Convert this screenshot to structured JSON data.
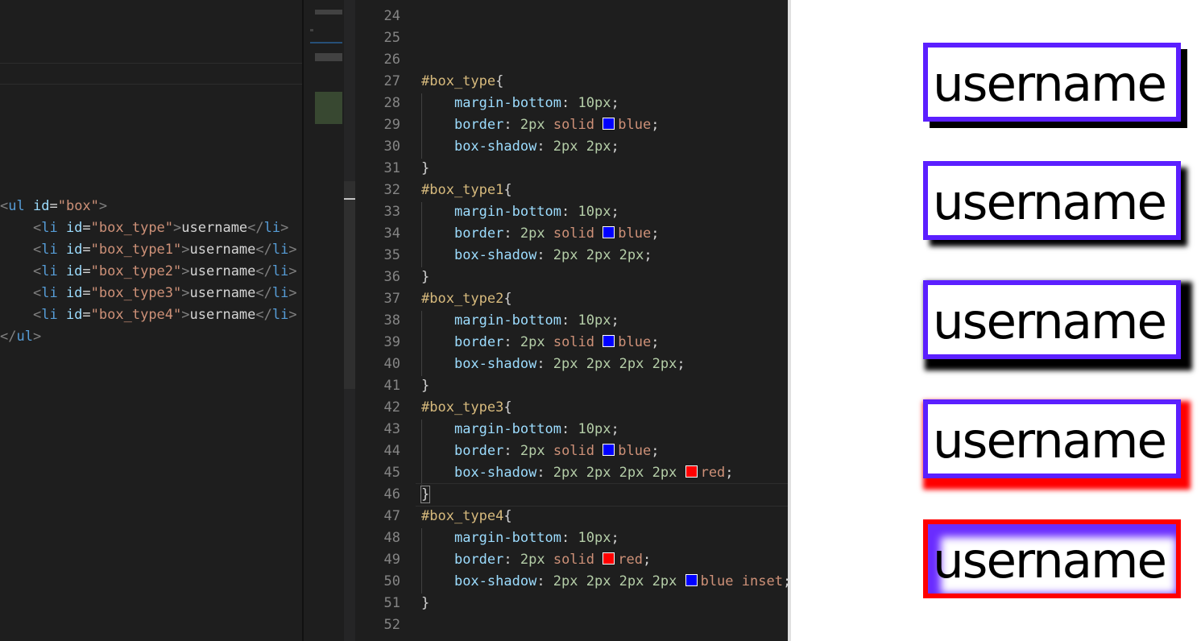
{
  "html_panel": {
    "lines": [
      [
        {
          "c": "t-punc",
          "t": "<"
        },
        {
          "c": "t-tag",
          "t": "ul"
        },
        {
          "c": "t-txt",
          "t": " "
        },
        {
          "c": "t-attr",
          "t": "id"
        },
        {
          "c": "t-eq",
          "t": "="
        },
        {
          "c": "t-str",
          "t": "\"box\""
        },
        {
          "c": "t-punc",
          "t": ">"
        }
      ],
      [
        {
          "c": "t-txt",
          "t": "    "
        },
        {
          "c": "t-punc",
          "t": "<"
        },
        {
          "c": "t-tag",
          "t": "li"
        },
        {
          "c": "t-txt",
          "t": " "
        },
        {
          "c": "t-attr",
          "t": "id"
        },
        {
          "c": "t-eq",
          "t": "="
        },
        {
          "c": "t-str",
          "t": "\"box_type\""
        },
        {
          "c": "t-punc",
          "t": ">"
        },
        {
          "c": "t-txt",
          "t": "username"
        },
        {
          "c": "t-punc",
          "t": "</"
        },
        {
          "c": "t-tag",
          "t": "li"
        },
        {
          "c": "t-punc",
          "t": ">"
        }
      ],
      [
        {
          "c": "t-txt",
          "t": "    "
        },
        {
          "c": "t-punc",
          "t": "<"
        },
        {
          "c": "t-tag",
          "t": "li"
        },
        {
          "c": "t-txt",
          "t": " "
        },
        {
          "c": "t-attr",
          "t": "id"
        },
        {
          "c": "t-eq",
          "t": "="
        },
        {
          "c": "t-str",
          "t": "\"box_type1\""
        },
        {
          "c": "t-punc",
          "t": ">"
        },
        {
          "c": "t-txt",
          "t": "username"
        },
        {
          "c": "t-punc",
          "t": "</"
        },
        {
          "c": "t-tag",
          "t": "li"
        },
        {
          "c": "t-punc",
          "t": ">"
        }
      ],
      [
        {
          "c": "t-txt",
          "t": "    "
        },
        {
          "c": "t-punc",
          "t": "<"
        },
        {
          "c": "t-tag",
          "t": "li"
        },
        {
          "c": "t-txt",
          "t": " "
        },
        {
          "c": "t-attr",
          "t": "id"
        },
        {
          "c": "t-eq",
          "t": "="
        },
        {
          "c": "t-str",
          "t": "\"box_type2\""
        },
        {
          "c": "t-punc",
          "t": ">"
        },
        {
          "c": "t-txt",
          "t": "username"
        },
        {
          "c": "t-punc",
          "t": "</"
        },
        {
          "c": "t-tag",
          "t": "li"
        },
        {
          "c": "t-punc",
          "t": ">"
        }
      ],
      [
        {
          "c": "t-txt",
          "t": "    "
        },
        {
          "c": "t-punc",
          "t": "<"
        },
        {
          "c": "t-tag",
          "t": "li"
        },
        {
          "c": "t-txt",
          "t": " "
        },
        {
          "c": "t-attr",
          "t": "id"
        },
        {
          "c": "t-eq",
          "t": "="
        },
        {
          "c": "t-str",
          "t": "\"box_type3\""
        },
        {
          "c": "t-punc",
          "t": ">"
        },
        {
          "c": "t-txt",
          "t": "username"
        },
        {
          "c": "t-punc",
          "t": "</"
        },
        {
          "c": "t-tag",
          "t": "li"
        },
        {
          "c": "t-punc",
          "t": ">"
        }
      ],
      [
        {
          "c": "t-txt",
          "t": "    "
        },
        {
          "c": "t-punc",
          "t": "<"
        },
        {
          "c": "t-tag",
          "t": "li"
        },
        {
          "c": "t-txt",
          "t": " "
        },
        {
          "c": "t-attr",
          "t": "id"
        },
        {
          "c": "t-eq",
          "t": "="
        },
        {
          "c": "t-str",
          "t": "\"box_type4\""
        },
        {
          "c": "t-punc",
          "t": ">"
        },
        {
          "c": "t-txt",
          "t": "username"
        },
        {
          "c": "t-punc",
          "t": "</"
        },
        {
          "c": "t-tag",
          "t": "li"
        },
        {
          "c": "t-punc",
          "t": ">"
        }
      ],
      [
        {
          "c": "t-punc",
          "t": "</"
        },
        {
          "c": "t-tag",
          "t": "ul"
        },
        {
          "c": "t-punc",
          "t": ">"
        }
      ]
    ]
  },
  "css_panel": {
    "lines": [
      {
        "n": "24",
        "p": []
      },
      {
        "n": "25",
        "p": []
      },
      {
        "n": "26",
        "p": []
      },
      {
        "n": "27",
        "p": [
          {
            "c": "sel",
            "t": "#box_type"
          },
          {
            "c": "brace",
            "t": "{"
          }
        ]
      },
      {
        "n": "28",
        "p": [
          {
            "c": "brace",
            "t": "    "
          },
          {
            "c": "prop",
            "t": "margin-bottom"
          },
          {
            "c": "brace",
            "t": ": "
          },
          {
            "c": "num",
            "t": "10px"
          },
          {
            "c": "brace",
            "t": ";"
          }
        ]
      },
      {
        "n": "29",
        "p": [
          {
            "c": "brace",
            "t": "    "
          },
          {
            "c": "prop",
            "t": "border"
          },
          {
            "c": "brace",
            "t": ": "
          },
          {
            "c": "num",
            "t": "2px"
          },
          {
            "c": "brace",
            "t": " "
          },
          {
            "c": "kw",
            "t": "solid"
          },
          {
            "c": "brace",
            "t": " "
          },
          {
            "c": "swatch",
            "t": "#0000ff"
          },
          {
            "c": "kw",
            "t": "blue"
          },
          {
            "c": "brace",
            "t": ";"
          }
        ]
      },
      {
        "n": "30",
        "p": [
          {
            "c": "brace",
            "t": "    "
          },
          {
            "c": "prop",
            "t": "box-shadow"
          },
          {
            "c": "brace",
            "t": ": "
          },
          {
            "c": "num",
            "t": "2px 2px"
          },
          {
            "c": "brace",
            "t": ";"
          }
        ]
      },
      {
        "n": "31",
        "p": [
          {
            "c": "brace",
            "t": "}"
          }
        ]
      },
      {
        "n": "32",
        "p": [
          {
            "c": "sel",
            "t": "#box_type1"
          },
          {
            "c": "brace",
            "t": "{"
          }
        ]
      },
      {
        "n": "33",
        "p": [
          {
            "c": "brace",
            "t": "    "
          },
          {
            "c": "prop",
            "t": "margin-bottom"
          },
          {
            "c": "brace",
            "t": ": "
          },
          {
            "c": "num",
            "t": "10px"
          },
          {
            "c": "brace",
            "t": ";"
          }
        ]
      },
      {
        "n": "34",
        "p": [
          {
            "c": "brace",
            "t": "    "
          },
          {
            "c": "prop",
            "t": "border"
          },
          {
            "c": "brace",
            "t": ": "
          },
          {
            "c": "num",
            "t": "2px"
          },
          {
            "c": "brace",
            "t": " "
          },
          {
            "c": "kw",
            "t": "solid"
          },
          {
            "c": "brace",
            "t": " "
          },
          {
            "c": "swatch",
            "t": "#0000ff"
          },
          {
            "c": "kw",
            "t": "blue"
          },
          {
            "c": "brace",
            "t": ";"
          }
        ]
      },
      {
        "n": "35",
        "p": [
          {
            "c": "brace",
            "t": "    "
          },
          {
            "c": "prop",
            "t": "box-shadow"
          },
          {
            "c": "brace",
            "t": ": "
          },
          {
            "c": "num",
            "t": "2px 2px 2px"
          },
          {
            "c": "brace",
            "t": ";"
          }
        ]
      },
      {
        "n": "36",
        "p": [
          {
            "c": "brace",
            "t": "}"
          }
        ]
      },
      {
        "n": "37",
        "p": [
          {
            "c": "sel",
            "t": "#box_type2"
          },
          {
            "c": "brace",
            "t": "{"
          }
        ]
      },
      {
        "n": "38",
        "p": [
          {
            "c": "brace",
            "t": "    "
          },
          {
            "c": "prop",
            "t": "margin-bottom"
          },
          {
            "c": "brace",
            "t": ": "
          },
          {
            "c": "num",
            "t": "10px"
          },
          {
            "c": "brace",
            "t": ";"
          }
        ]
      },
      {
        "n": "39",
        "p": [
          {
            "c": "brace",
            "t": "    "
          },
          {
            "c": "prop",
            "t": "border"
          },
          {
            "c": "brace",
            "t": ": "
          },
          {
            "c": "num",
            "t": "2px"
          },
          {
            "c": "brace",
            "t": " "
          },
          {
            "c": "kw",
            "t": "solid"
          },
          {
            "c": "brace",
            "t": " "
          },
          {
            "c": "swatch",
            "t": "#0000ff"
          },
          {
            "c": "kw",
            "t": "blue"
          },
          {
            "c": "brace",
            "t": ";"
          }
        ]
      },
      {
        "n": "40",
        "p": [
          {
            "c": "brace",
            "t": "    "
          },
          {
            "c": "prop",
            "t": "box-shadow"
          },
          {
            "c": "brace",
            "t": ": "
          },
          {
            "c": "num",
            "t": "2px 2px 2px 2px"
          },
          {
            "c": "brace",
            "t": ";"
          }
        ]
      },
      {
        "n": "41",
        "p": [
          {
            "c": "brace",
            "t": "}"
          }
        ]
      },
      {
        "n": "42",
        "p": [
          {
            "c": "sel",
            "t": "#box_type3"
          },
          {
            "c": "brace",
            "t": "{"
          }
        ]
      },
      {
        "n": "43",
        "p": [
          {
            "c": "brace",
            "t": "    "
          },
          {
            "c": "prop",
            "t": "margin-bottom"
          },
          {
            "c": "brace",
            "t": ": "
          },
          {
            "c": "num",
            "t": "10px"
          },
          {
            "c": "brace",
            "t": ";"
          }
        ]
      },
      {
        "n": "44",
        "p": [
          {
            "c": "brace",
            "t": "    "
          },
          {
            "c": "prop",
            "t": "border"
          },
          {
            "c": "brace",
            "t": ": "
          },
          {
            "c": "num",
            "t": "2px"
          },
          {
            "c": "brace",
            "t": " "
          },
          {
            "c": "kw",
            "t": "solid"
          },
          {
            "c": "brace",
            "t": " "
          },
          {
            "c": "swatch",
            "t": "#0000ff"
          },
          {
            "c": "kw",
            "t": "blue"
          },
          {
            "c": "brace",
            "t": ";"
          }
        ]
      },
      {
        "n": "45",
        "p": [
          {
            "c": "brace",
            "t": "    "
          },
          {
            "c": "prop",
            "t": "box-shadow"
          },
          {
            "c": "brace",
            "t": ": "
          },
          {
            "c": "num",
            "t": "2px 2px 2px 2px"
          },
          {
            "c": "brace",
            "t": " "
          },
          {
            "c": "swatch",
            "t": "#ff0000"
          },
          {
            "c": "kw",
            "t": "red"
          },
          {
            "c": "brace",
            "t": ";"
          }
        ]
      },
      {
        "n": "46",
        "p": [
          {
            "c": "brace",
            "t": "}"
          }
        ]
      },
      {
        "n": "47",
        "p": [
          {
            "c": "sel",
            "t": "#box_type4"
          },
          {
            "c": "brace",
            "t": "{"
          }
        ]
      },
      {
        "n": "48",
        "p": [
          {
            "c": "brace",
            "t": "    "
          },
          {
            "c": "prop",
            "t": "margin-bottom"
          },
          {
            "c": "brace",
            "t": ": "
          },
          {
            "c": "num",
            "t": "10px"
          },
          {
            "c": "brace",
            "t": ";"
          }
        ]
      },
      {
        "n": "49",
        "p": [
          {
            "c": "brace",
            "t": "    "
          },
          {
            "c": "prop",
            "t": "border"
          },
          {
            "c": "brace",
            "t": ": "
          },
          {
            "c": "num",
            "t": "2px"
          },
          {
            "c": "brace",
            "t": " "
          },
          {
            "c": "kw",
            "t": "solid"
          },
          {
            "c": "brace",
            "t": " "
          },
          {
            "c": "swatch",
            "t": "#ff0000"
          },
          {
            "c": "kw",
            "t": "red"
          },
          {
            "c": "brace",
            "t": ";"
          }
        ]
      },
      {
        "n": "50",
        "p": [
          {
            "c": "brace",
            "t": "    "
          },
          {
            "c": "prop",
            "t": "box-shadow"
          },
          {
            "c": "brace",
            "t": ": "
          },
          {
            "c": "num",
            "t": "2px 2px 2px 2px"
          },
          {
            "c": "brace",
            "t": " "
          },
          {
            "c": "swatch",
            "t": "#0000ff"
          },
          {
            "c": "kw",
            "t": "blue inset"
          },
          {
            "c": "brace",
            "t": ";"
          }
        ]
      },
      {
        "n": "51",
        "p": [
          {
            "c": "brace",
            "t": "}"
          }
        ]
      },
      {
        "n": "52",
        "p": []
      }
    ]
  },
  "preview": {
    "items": [
      "username",
      "username",
      "username",
      "username",
      "username"
    ]
  },
  "colors": {
    "editor_bg": "#1e1e1e",
    "border_blue": "#5b1fff",
    "red": "#ff0000",
    "shadow": "#000000"
  }
}
